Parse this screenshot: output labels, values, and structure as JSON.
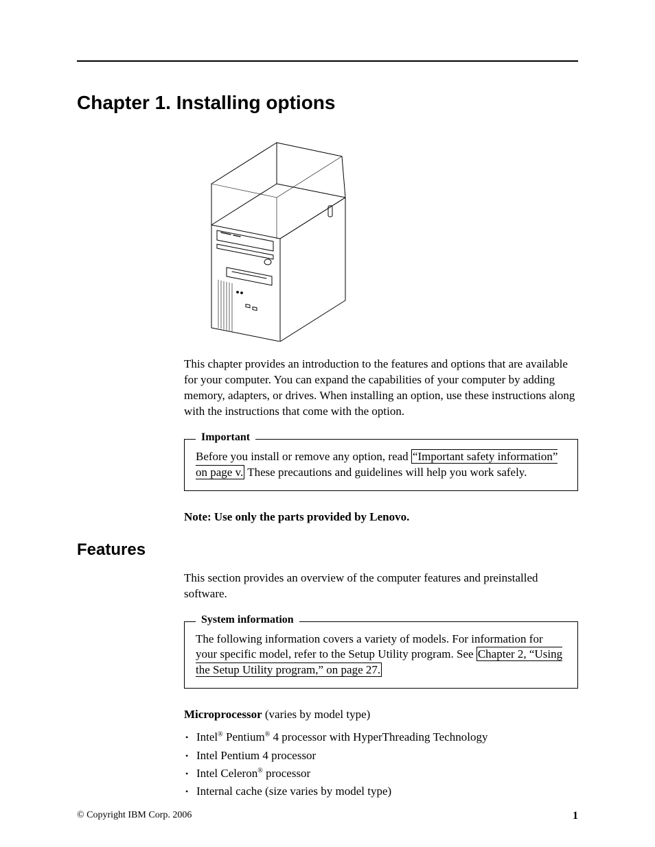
{
  "chapter_title": "Chapter 1. Installing options",
  "intro_para": "This chapter provides an introduction to the features and options that are available for your computer. You can expand the capabilities of your computer by adding memory, adapters, or drives. When installing an option, use these instructions along with the instructions that come with the option.",
  "important_box": {
    "legend": "Important",
    "before_link": "Before you install or remove any option, read ",
    "link_text": "“Important safety information” on page v.",
    "after_link": " These precautions and guidelines will help you work safely."
  },
  "note_line": "Note:  Use only the parts provided by Lenovo.",
  "features_heading": "Features",
  "features_intro": "This section provides an overview of the computer features and preinstalled software.",
  "sysinfo_box": {
    "legend": "System information",
    "before_link": "The following information covers a variety of models. For information for your specific model, refer to the Setup Utility program. See ",
    "link_text": "Chapter 2, “Using the Setup Utility program,” on page 27.",
    "after_link": ""
  },
  "micro_heading_bold": "Microprocessor",
  "micro_heading_rest": " (varies by model type)",
  "micro_items": {
    "item1_a": "Intel",
    "item1_b": " Pentium",
    "item1_c": " 4 processor with HyperThreading Technology",
    "item2": "Intel Pentium 4 processor",
    "item3_a": "Intel Celeron",
    "item3_b": " processor",
    "item4": "Internal cache (size varies by model type)"
  },
  "reg": "®",
  "footer_left": "© Copyright IBM Corp. 2006",
  "footer_right": "1"
}
